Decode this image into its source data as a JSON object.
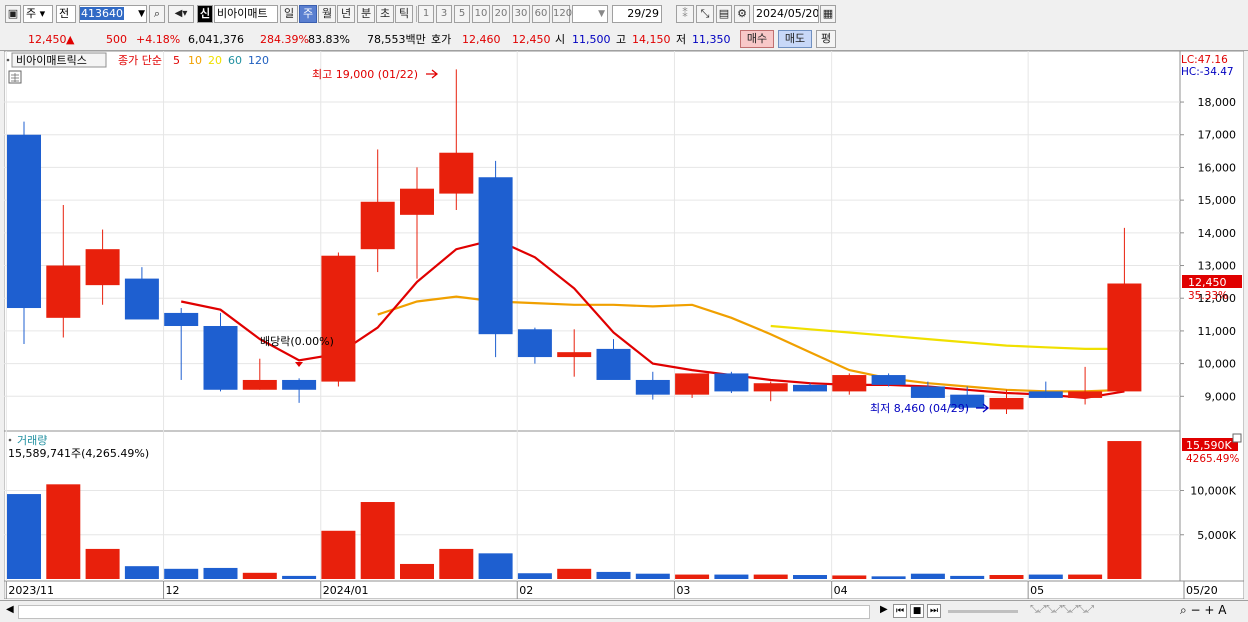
{
  "toolbar": {
    "type_select": "주",
    "market_select": "전",
    "code": "413640",
    "badge": "신",
    "stock_name": "비아이매트",
    "periods": [
      "일",
      "주",
      "월",
      "년",
      "분",
      "초",
      "틱"
    ],
    "active_period": "주",
    "ticks": [
      "1",
      "3",
      "5",
      "10",
      "20",
      "30",
      "60",
      "120"
    ],
    "count": "29/29",
    "date": "2024/05/20"
  },
  "quote": {
    "price": "12,450",
    "arrow": "▲",
    "change": "500",
    "change_pct": "+4.18%",
    "volume": "6,041,376",
    "volume_pct": "284.39%",
    "ratio": "83.83%",
    "amount": "78,553백만",
    "ask_label": "호가",
    "ask": "12,460",
    "bid": "12,450",
    "open_label": "시",
    "open": "11,500",
    "high_label": "고",
    "high": "14,150",
    "low_label": "저",
    "low": "11,350",
    "buy_label": "매수",
    "sell_label": "매도",
    "avg_label": "평"
  },
  "price_panel": {
    "name_tag": "비아이매트릭스",
    "ma_title": "종가 단순",
    "ma_periods": [
      "5",
      "10",
      "20",
      "60",
      "120"
    ],
    "ma_colors": [
      "#e00000",
      "#f0a000",
      "#f0e000",
      "#2090a0",
      "#2060c0"
    ],
    "lc": "LC:47.16",
    "hc": "HC:-34.47",
    "current_tag": "12,450",
    "current_pct": "35.33%",
    "annotation_high": "최고 19,000 (01/22)",
    "annotation_low": "최저 8,460 (04/29)",
    "annotation_event": "배당락(0.00%)"
  },
  "volume_panel": {
    "title": "거래량",
    "value_text": "15,589,741주(4,265.49%)",
    "current_tag": "15,590K",
    "current_pct": "4265.49%"
  },
  "chart_data": {
    "type": "candlestick",
    "title": "",
    "x_labels": [
      {
        "label": "2023/11",
        "index": 0
      },
      {
        "label": "12",
        "index": 4
      },
      {
        "label": "2024/01",
        "index": 8
      },
      {
        "label": "02",
        "index": 13
      },
      {
        "label": "03",
        "index": 17
      },
      {
        "label": "04",
        "index": 21
      },
      {
        "label": "05",
        "index": 26
      },
      {
        "label": "05/20",
        "index": 29
      }
    ],
    "ylim": [
      8000,
      19500
    ],
    "yticks": [
      9000,
      10000,
      11000,
      12000,
      13000,
      14000,
      15000,
      16000,
      17000,
      18000
    ],
    "candles": [
      {
        "o": 17000,
        "h": 17400,
        "l": 10600,
        "c": 11700
      },
      {
        "o": 11400,
        "h": 14850,
        "l": 10800,
        "c": 13000
      },
      {
        "o": 12400,
        "h": 14100,
        "l": 11800,
        "c": 13500
      },
      {
        "o": 12600,
        "h": 12950,
        "l": 11400,
        "c": 11350
      },
      {
        "o": 11550,
        "h": 11700,
        "l": 9500,
        "c": 11150
      },
      {
        "o": 11150,
        "h": 11550,
        "l": 9150,
        "c": 9200
      },
      {
        "o": 9200,
        "h": 10150,
        "l": 9200,
        "c": 9500
      },
      {
        "o": 9500,
        "h": 9550,
        "l": 8800,
        "c": 9200
      },
      {
        "o": 9450,
        "h": 13400,
        "l": 9300,
        "c": 13300
      },
      {
        "o": 13500,
        "h": 16550,
        "l": 12800,
        "c": 14950
      },
      {
        "o": 14550,
        "h": 16000,
        "l": 12600,
        "c": 15350
      },
      {
        "o": 15200,
        "h": 19000,
        "l": 14700,
        "c": 16450
      },
      {
        "o": 15700,
        "h": 16200,
        "l": 10200,
        "c": 10900
      },
      {
        "o": 11050,
        "h": 11100,
        "l": 10000,
        "c": 10200
      },
      {
        "o": 10200,
        "h": 11050,
        "l": 9600,
        "c": 10350
      },
      {
        "o": 10450,
        "h": 10750,
        "l": 9550,
        "c": 9500
      },
      {
        "o": 9500,
        "h": 9750,
        "l": 8900,
        "c": 9050
      },
      {
        "o": 9050,
        "h": 9700,
        "l": 8950,
        "c": 9700
      },
      {
        "o": 9700,
        "h": 9750,
        "l": 9100,
        "c": 9150
      },
      {
        "o": 9150,
        "h": 9450,
        "l": 8850,
        "c": 9400
      },
      {
        "o": 9350,
        "h": 9400,
        "l": 9150,
        "c": 9150
      },
      {
        "o": 9150,
        "h": 9700,
        "l": 9050,
        "c": 9650
      },
      {
        "o": 9650,
        "h": 9700,
        "l": 9300,
        "c": 9350
      },
      {
        "o": 9300,
        "h": 9450,
        "l": 8950,
        "c": 8950
      },
      {
        "o": 9050,
        "h": 9300,
        "l": 8550,
        "c": 8650
      },
      {
        "o": 8600,
        "h": 9200,
        "l": 8460,
        "c": 8950
      },
      {
        "o": 9150,
        "h": 9450,
        "l": 8950,
        "c": 8950
      },
      {
        "o": 8950,
        "h": 9900,
        "l": 8750,
        "c": 9150
      },
      {
        "o": 9150,
        "h": 14150,
        "l": 9150,
        "c": 12450
      }
    ],
    "ma5": [
      null,
      null,
      null,
      null,
      11900,
      11650,
      10750,
      10100,
      10300,
      11100,
      12500,
      13500,
      13800,
      13250,
      12300,
      10950,
      10000,
      9800,
      9650,
      9500,
      9400,
      9350,
      9350,
      9300,
      9200,
      9100,
      9050,
      8950,
      9150
    ],
    "ma10": [
      null,
      null,
      null,
      null,
      null,
      null,
      null,
      null,
      null,
      11500,
      11900,
      12050,
      11900,
      11850,
      11800,
      11800,
      11750,
      11800,
      11400,
      10900,
      10350,
      9800,
      9550,
      9400,
      9300,
      9200,
      9150,
      9150,
      9200
    ],
    "ma20": [
      null,
      null,
      null,
      null,
      null,
      null,
      null,
      null,
      null,
      null,
      null,
      null,
      null,
      null,
      null,
      null,
      null,
      null,
      null,
      11150,
      11050,
      10950,
      10850,
      10750,
      10650,
      10550,
      10500,
      10450,
      10450
    ],
    "volume_ylim": [
      0,
      16500
    ],
    "volume_yticks": [
      5000,
      10000
    ],
    "volume_unit": "K",
    "volumes": [
      9600,
      10700,
      3400,
      1450,
      1150,
      1250,
      700,
      350,
      5450,
      8700,
      1700,
      3400,
      2900,
      650,
      1150,
      800,
      600,
      500,
      500,
      500,
      450,
      400,
      300,
      600,
      350,
      450,
      500,
      500,
      15590
    ]
  }
}
